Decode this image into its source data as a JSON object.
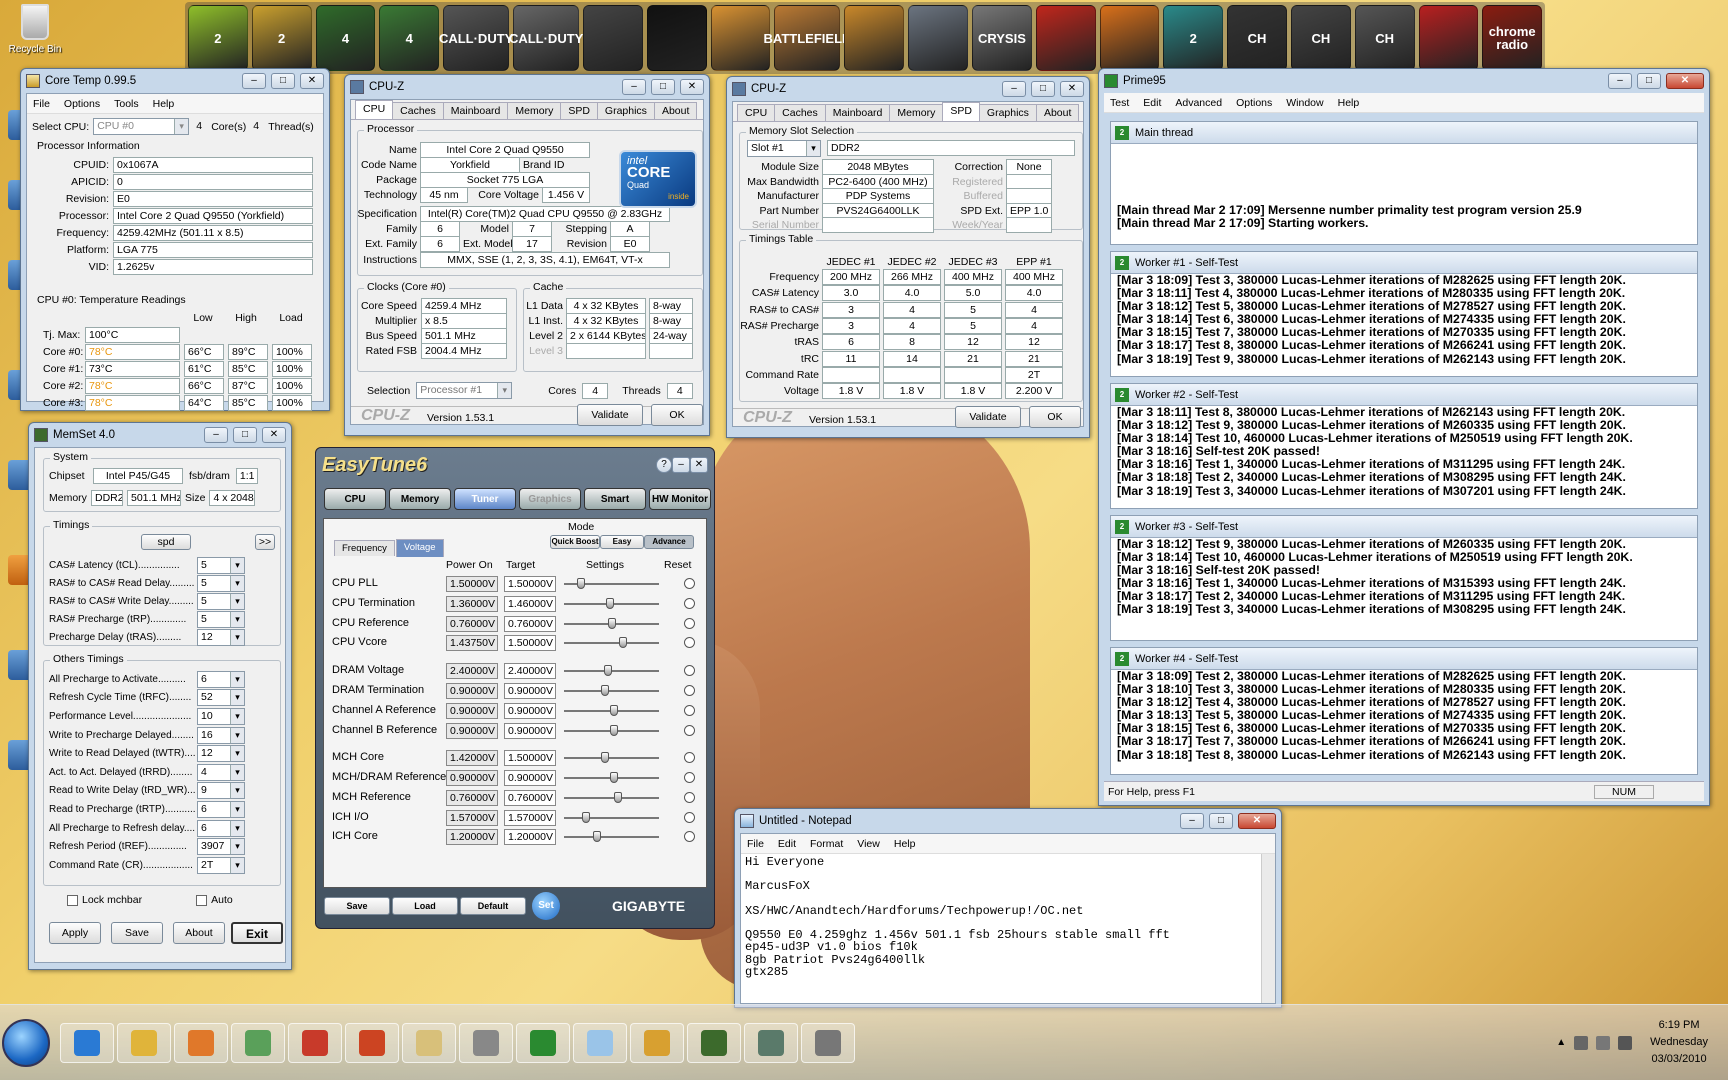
{
  "desktop": {
    "recycle_bin": "Recycle Bin"
  },
  "launcher": {
    "icons": [
      {
        "name": "cod2-icon",
        "label": "2",
        "color": "#8fbf2a"
      },
      {
        "name": "cod2-gold-icon",
        "label": "2",
        "color": "#caa02e"
      },
      {
        "name": "l4d-icon",
        "label": "4",
        "color": "#2f6b2a"
      },
      {
        "name": "l4d2-icon",
        "label": "4",
        "color": "#3a7a34"
      },
      {
        "name": "callofduty-icon",
        "label": "CALL·DUTY",
        "color": "#555"
      },
      {
        "name": "callofduty2-icon",
        "label": "CALL·DUTY",
        "color": "#666"
      },
      {
        "name": "soldier-icon",
        "label": "",
        "color": "#444"
      },
      {
        "name": "steam-icon",
        "label": "",
        "color": "#111"
      },
      {
        "name": "counterstrike-icon",
        "label": "",
        "color": "#d99232"
      },
      {
        "name": "battlefield-icon",
        "label": "BATTLEFIELD",
        "color": "#bb7a33"
      },
      {
        "name": "medal-icon",
        "label": "",
        "color": "#c9882a"
      },
      {
        "name": "crysis-icon",
        "label": "",
        "color": "#6b7480"
      },
      {
        "name": "crysis-warhead-icon",
        "label": "CRYSIS",
        "color": "#777"
      },
      {
        "name": "runner-icon",
        "label": "",
        "color": "#c0261c"
      },
      {
        "name": "swirl-icon",
        "label": "",
        "color": "#d9701a"
      },
      {
        "name": "l4d-swirl-icon",
        "label": "2",
        "color": "#2a8a8a"
      },
      {
        "name": "coh-icon",
        "label": "CH",
        "color": "#333"
      },
      {
        "name": "coh2-icon",
        "label": "CH",
        "color": "#444"
      },
      {
        "name": "coh3-icon",
        "label": "CH",
        "color": "#555"
      },
      {
        "name": "zombie-icon",
        "label": "",
        "color": "#b82020"
      },
      {
        "name": "skull-radio-icon",
        "label": "chrome radio",
        "color": "#8a1c10"
      }
    ]
  },
  "coretemp": {
    "title": "Core Temp 0.99.5",
    "menu": [
      "File",
      "Options",
      "Tools",
      "Help"
    ],
    "select_cpu_label": "Select CPU:",
    "select_cpu": "CPU #0",
    "cores_value": "4",
    "cores_label": "Core(s)",
    "threads_value": "4",
    "threads_label": "Thread(s)",
    "proc_info_title": "Processor Information",
    "info": [
      {
        "label": "CPUID:",
        "value": "0x1067A"
      },
      {
        "label": "APICID:",
        "value": "0"
      },
      {
        "label": "Revision:",
        "value": "E0"
      },
      {
        "label": "Processor:",
        "value": "Intel Core 2 Quad Q9550 (Yorkfield)"
      },
      {
        "label": "Frequency:",
        "value": "4259.42MHz (501.11 x 8.5)"
      },
      {
        "label": "Platform:",
        "value": "LGA 775"
      },
      {
        "label": "VID:",
        "value": "1.2625v"
      }
    ],
    "temps_title": "CPU #0: Temperature Readings",
    "temp_headers": [
      "Low",
      "High",
      "Load"
    ],
    "tjmax_label": "Tj. Max:",
    "tjmax": "100°C",
    "cores": [
      {
        "label": "Core #0:",
        "temp": "78°C",
        "low": "66°C",
        "high": "89°C",
        "load": "100%",
        "hot": true
      },
      {
        "label": "Core #1:",
        "temp": "73°C",
        "low": "61°C",
        "high": "85°C",
        "load": "100%",
        "hot": false
      },
      {
        "label": "Core #2:",
        "temp": "78°C",
        "low": "66°C",
        "high": "87°C",
        "load": "100%",
        "hot": true
      },
      {
        "label": "Core #3:",
        "temp": "78°C",
        "low": "64°C",
        "high": "85°C",
        "load": "100%",
        "hot": true
      }
    ]
  },
  "cpuz1": {
    "title": "CPU-Z",
    "tabs": [
      "CPU",
      "Caches",
      "Mainboard",
      "Memory",
      "SPD",
      "Graphics",
      "About"
    ],
    "processor_group": "Processor",
    "fields": {
      "name_l": "Name",
      "name": "Intel Core 2 Quad Q9550",
      "code_l": "Code Name",
      "code": "Yorkfield",
      "brand_l": "Brand ID",
      "package_l": "Package",
      "package": "Socket 775 LGA",
      "tech_l": "Technology",
      "tech": "45 nm",
      "cv_l": "Core Voltage",
      "cv": "1.456 V",
      "spec_l": "Specification",
      "spec": "Intel(R) Core(TM)2 Quad CPU    Q9550  @ 2.83GHz",
      "family_l": "Family",
      "family": "6",
      "model_l": "Model",
      "model": "7",
      "stepping_l": "Stepping",
      "stepping": "A",
      "extfam_l": "Ext. Family",
      "extfam": "6",
      "extmodel_l": "Ext. Model",
      "extmodel": "17",
      "rev_l": "Revision",
      "rev": "E0",
      "instr_l": "Instructions",
      "instr": "MMX, SSE (1, 2, 3, 3S, 4.1), EM64T, VT-x"
    },
    "logo": {
      "brand": "intel",
      "line1": "CORE",
      "line2": "Quad",
      "line3": "inside"
    },
    "clocks_group": "Clocks (Core #0)",
    "clocks": [
      {
        "label": "Core Speed",
        "value": "4259.4 MHz"
      },
      {
        "label": "Multiplier",
        "value": "x 8.5"
      },
      {
        "label": "Bus Speed",
        "value": "501.1 MHz"
      },
      {
        "label": "Rated FSB",
        "value": "2004.4 MHz"
      }
    ],
    "cache_group": "Cache",
    "cache": [
      {
        "label": "L1 Data",
        "value": "4 x 32 KBytes",
        "way": "8-way"
      },
      {
        "label": "L1 Inst.",
        "value": "4 x 32 KBytes",
        "way": "8-way"
      },
      {
        "label": "Level 2",
        "value": "2 x 6144 KBytes",
        "way": "24-way"
      },
      {
        "label": "Level 3",
        "value": "",
        "way": ""
      }
    ],
    "selection_l": "Selection",
    "selection": "Processor #1",
    "cores_l": "Cores",
    "cores": "4",
    "threads_l": "Threads",
    "threads": "4",
    "brand": "CPU-Z",
    "version": "Version 1.53.1",
    "validate": "Validate",
    "ok": "OK"
  },
  "cpuz2": {
    "title": "CPU-Z",
    "tabs": [
      "CPU",
      "Caches",
      "Mainboard",
      "Memory",
      "SPD",
      "Graphics",
      "About"
    ],
    "slot_group": "Memory Slot Selection",
    "slot": "Slot #1",
    "type": "DDR2",
    "rows": [
      {
        "label": "Module Size",
        "value": "2048 MBytes",
        "label2": "Correction",
        "value2": "None"
      },
      {
        "label": "Max Bandwidth",
        "value": "PC2-6400 (400 MHz)",
        "label2": "Registered",
        "value2": ""
      },
      {
        "label": "Manufacturer",
        "value": "PDP Systems",
        "label2": "Buffered",
        "value2": ""
      },
      {
        "label": "Part Number",
        "value": "PVS24G6400LLK",
        "label2": "SPD Ext.",
        "value2": "EPP 1.0"
      },
      {
        "label": "Serial Number",
        "value": "",
        "label2": "Week/Year",
        "value2": ""
      }
    ],
    "timings_group": "Timings Table",
    "timing_headers": [
      "JEDEC #1",
      "JEDEC #2",
      "JEDEC #3",
      "EPP #1"
    ],
    "timings": [
      {
        "label": "Frequency",
        "v": [
          "200 MHz",
          "266 MHz",
          "400 MHz",
          "400 MHz"
        ]
      },
      {
        "label": "CAS# Latency",
        "v": [
          "3.0",
          "4.0",
          "5.0",
          "4.0"
        ]
      },
      {
        "label": "RAS# to CAS#",
        "v": [
          "3",
          "4",
          "5",
          "4"
        ]
      },
      {
        "label": "RAS# Precharge",
        "v": [
          "3",
          "4",
          "5",
          "4"
        ]
      },
      {
        "label": "tRAS",
        "v": [
          "6",
          "8",
          "12",
          "12"
        ]
      },
      {
        "label": "tRC",
        "v": [
          "11",
          "14",
          "21",
          "21"
        ]
      },
      {
        "label": "Command Rate",
        "v": [
          "",
          "",
          "",
          "2T"
        ]
      },
      {
        "label": "Voltage",
        "v": [
          "1.8 V",
          "1.8 V",
          "1.8 V",
          "2.200 V"
        ]
      }
    ],
    "brand": "CPU-Z",
    "version": "Version 1.53.1",
    "validate": "Validate",
    "ok": "OK"
  },
  "prime95": {
    "title": "Prime95",
    "menu": [
      "Test",
      "Edit",
      "Advanced",
      "Options",
      "Window",
      "Help"
    ],
    "panes": [
      {
        "title": "Main thread",
        "lines": [
          "[Main thread Mar 2 17:09] Mersenne number primality test program version 25.9",
          "[Main thread Mar 2 17:09] Starting workers."
        ]
      },
      {
        "title": "Worker #1 - Self-Test",
        "lines": [
          "[Mar 3 18:09] Test 3, 380000 Lucas-Lehmer iterations of M282625 using FFT length 20K.",
          "[Mar 3 18:11] Test 4, 380000 Lucas-Lehmer iterations of M280335 using FFT length 20K.",
          "[Mar 3 18:12] Test 5, 380000 Lucas-Lehmer iterations of M278527 using FFT length 20K.",
          "[Mar 3 18:14] Test 6, 380000 Lucas-Lehmer iterations of M274335 using FFT length 20K.",
          "[Mar 3 18:15] Test 7, 380000 Lucas-Lehmer iterations of M270335 using FFT length 20K.",
          "[Mar 3 18:17] Test 8, 380000 Lucas-Lehmer iterations of M266241 using FFT length 20K.",
          "[Mar 3 18:19] Test 9, 380000 Lucas-Lehmer iterations of M262143 using FFT length 20K."
        ]
      },
      {
        "title": "Worker #2 - Self-Test",
        "lines": [
          "[Mar 3 18:11] Test 8, 380000 Lucas-Lehmer iterations of M262143 using FFT length 20K.",
          "[Mar 3 18:12] Test 9, 380000 Lucas-Lehmer iterations of M260335 using FFT length 20K.",
          "[Mar 3 18:14] Test 10, 460000 Lucas-Lehmer iterations of M250519 using FFT length 20K.",
          "[Mar 3 18:16] Self-test 20K passed!",
          "[Mar 3 18:16] Test 1, 340000 Lucas-Lehmer iterations of M311295 using FFT length 24K.",
          "[Mar 3 18:18] Test 2, 340000 Lucas-Lehmer iterations of M308295 using FFT length 24K.",
          "[Mar 3 18:19] Test 3, 340000 Lucas-Lehmer iterations of M307201 using FFT length 24K."
        ]
      },
      {
        "title": "Worker #3 - Self-Test",
        "lines": [
          "[Mar 3 18:12] Test 9, 380000 Lucas-Lehmer iterations of M260335 using FFT length 20K.",
          "[Mar 3 18:14] Test 10, 460000 Lucas-Lehmer iterations of M250519 using FFT length 20K.",
          "[Mar 3 18:16] Self-test 20K passed!",
          "[Mar 3 18:16] Test 1, 340000 Lucas-Lehmer iterations of M315393 using FFT length 24K.",
          "[Mar 3 18:17] Test 2, 340000 Lucas-Lehmer iterations of M311295 using FFT length 24K.",
          "[Mar 3 18:19] Test 3, 340000 Lucas-Lehmer iterations of M308295 using FFT length 24K."
        ]
      },
      {
        "title": "Worker #4 - Self-Test",
        "lines": [
          "[Mar 3 18:09] Test 2, 380000 Lucas-Lehmer iterations of M282625 using FFT length 20K.",
          "[Mar 3 18:10] Test 3, 380000 Lucas-Lehmer iterations of M280335 using FFT length 20K.",
          "[Mar 3 18:12] Test 4, 380000 Lucas-Lehmer iterations of M278527 using FFT length 20K.",
          "[Mar 3 18:13] Test 5, 380000 Lucas-Lehmer iterations of M274335 using FFT length 20K.",
          "[Mar 3 18:15] Test 6, 380000 Lucas-Lehmer iterations of M270335 using FFT length 20K.",
          "[Mar 3 18:17] Test 7, 380000 Lucas-Lehmer iterations of M266241 using FFT length 20K.",
          "[Mar 3 18:18] Test 8, 380000 Lucas-Lehmer iterations of M262143 using FFT length 20K."
        ]
      }
    ],
    "status_left": "For Help, press F1",
    "status_num": "NUM"
  },
  "memset": {
    "title": "MemSet 4.0",
    "system_group": "System",
    "chipset_l": "Chipset",
    "chipset": "Intel P45/G45",
    "fsb_l": "fsb/dram",
    "fsb": "1:1",
    "memory_l": "Memory",
    "memory_type": "DDR2",
    "memory_freq": "501.1 MHz",
    "size_l": "Size",
    "size": "4 x 2048",
    "timings_group": "Timings",
    "spd_button": "spd",
    "more_button": ">>",
    "timings": [
      {
        "label": "CAS# Latency (tCL)...............",
        "value": "5"
      },
      {
        "label": "RAS# to CAS# Read Delay..........",
        "value": "5"
      },
      {
        "label": "RAS# to CAS# Write Delay.........",
        "value": "5"
      },
      {
        "label": "RAS# Precharge (tRP).............",
        "value": "5"
      },
      {
        "label": "Precharge Delay  (tRAS).........",
        "value": "12"
      }
    ],
    "others_group": "Others Timings",
    "others": [
      {
        "label": "All Precharge to Activate..........",
        "value": "6"
      },
      {
        "label": "Refresh Cycle Time (tRFC)........",
        "value": "52"
      },
      {
        "label": "Performance Level.....................",
        "value": "10"
      },
      {
        "label": "Write to Precharge Delayed........",
        "value": "16"
      },
      {
        "label": "Write to Read Delayed (tWTR)....",
        "value": "12"
      },
      {
        "label": "Act. to Act. Delayed (tRRD)........",
        "value": "4"
      },
      {
        "label": "Read to Write Delay (tRD_WR)....",
        "value": "9"
      },
      {
        "label": "Read to Precharge (tRTP)...........",
        "value": "6"
      },
      {
        "label": "All Precharge to Refresh delay.....",
        "value": "6"
      },
      {
        "label": "Refresh Period (tREF)..............",
        "value": "3907"
      },
      {
        "label": "Command Rate (CR)..................",
        "value": "2T"
      }
    ],
    "lock_l": "Lock mchbar",
    "auto_l": "Auto",
    "buttons": [
      "Apply",
      "Save",
      "About",
      "Exit"
    ]
  },
  "easytune": {
    "title": "EasyTune6",
    "tabs": [
      "CPU",
      "Memory",
      "Tuner",
      "Graphics",
      "Smart",
      "HW Monitor"
    ],
    "mode_label": "Mode",
    "modes": [
      "Quick Boost",
      "Easy",
      "Advance"
    ],
    "subtabs": [
      "Frequency",
      "Voltage"
    ],
    "headers": [
      "Power On",
      "Target",
      "Settings",
      "Reset"
    ],
    "rows": [
      {
        "label": "CPU PLL",
        "power_on": "1.50000V",
        "target": "1.50000V",
        "level": 0.15
      },
      {
        "label": "CPU Termination",
        "power_on": "1.36000V",
        "target": "1.46000V",
        "level": 0.48
      },
      {
        "label": "CPU Reference",
        "power_on": "0.76000V",
        "target": "0.76000V",
        "level": 0.5
      },
      {
        "label": "CPU Vcore",
        "power_on": "1.43750V",
        "target": "1.50000V",
        "level": 0.62
      },
      {
        "label": "DRAM Voltage",
        "power_on": "2.40000V",
        "target": "2.40000V",
        "level": 0.45
      },
      {
        "label": "DRAM Termination",
        "power_on": "0.90000V",
        "target": "0.90000V",
        "level": 0.42
      },
      {
        "label": "Channel A Reference",
        "power_on": "0.90000V",
        "target": "0.90000V",
        "level": 0.52
      },
      {
        "label": "Channel B Reference",
        "power_on": "0.90000V",
        "target": "0.90000V",
        "level": 0.52
      },
      {
        "label": "MCH Core",
        "power_on": "1.42000V",
        "target": "1.50000V",
        "level": 0.42
      },
      {
        "label": "MCH/DRAM Reference",
        "power_on": "0.90000V",
        "target": "0.90000V",
        "level": 0.52
      },
      {
        "label": "MCH Reference",
        "power_on": "0.76000V",
        "target": "0.76000V",
        "level": 0.57
      },
      {
        "label": "ICH I/O",
        "power_on": "1.57000V",
        "target": "1.57000V",
        "level": 0.2
      },
      {
        "label": "ICH Core",
        "power_on": "1.20000V",
        "target": "1.20000V",
        "level": 0.33
      }
    ],
    "buttons": [
      "Save",
      "Load",
      "Default"
    ],
    "set_button": "Set",
    "brand": "GIGABYTE"
  },
  "notepad": {
    "title": "Untitled - Notepad",
    "menu": [
      "File",
      "Edit",
      "Format",
      "View",
      "Help"
    ],
    "lines": [
      "Hi Everyone",
      "",
      "MarcusFoX",
      "",
      "XS/HWC/Anandtech/Hardforums/Techpowerup!/OC.net",
      "",
      "Q9550 E0 4.259ghz 1.456v 501.1 fsb 25hours stable small fft",
      "ep45-ud3P v1.0 bios f10k",
      "8gb Patriot Pvs24g6400llk",
      "gtx285"
    ]
  },
  "taskbar": {
    "items": [
      {
        "name": "ie-icon",
        "color": "#2a7ad4"
      },
      {
        "name": "explorer-icon",
        "color": "#e0b43a"
      },
      {
        "name": "media-player-icon",
        "color": "#e0782a"
      },
      {
        "name": "users-icon",
        "color": "#5aa05a"
      },
      {
        "name": "archive-icon",
        "color": "#c83a2a"
      },
      {
        "name": "satellite-icon",
        "color": "#cc4422"
      },
      {
        "name": "folder-icon",
        "color": "#d8c07a"
      },
      {
        "name": "headset-icon",
        "color": "#888"
      },
      {
        "name": "prime95-icon",
        "color": "#2a8a30"
      },
      {
        "name": "notepad-icon",
        "color": "#9ac4e8"
      },
      {
        "name": "coretemp-icon",
        "color": "#d8a030"
      },
      {
        "name": "memset-icon",
        "color": "#3c6a2c"
      },
      {
        "name": "easytune-icon",
        "color": "#5a7a6a"
      },
      {
        "name": "steering-icon",
        "color": "#777"
      }
    ],
    "time": "6:19 PM",
    "day": "Wednesday",
    "date": "03/03/2010"
  }
}
